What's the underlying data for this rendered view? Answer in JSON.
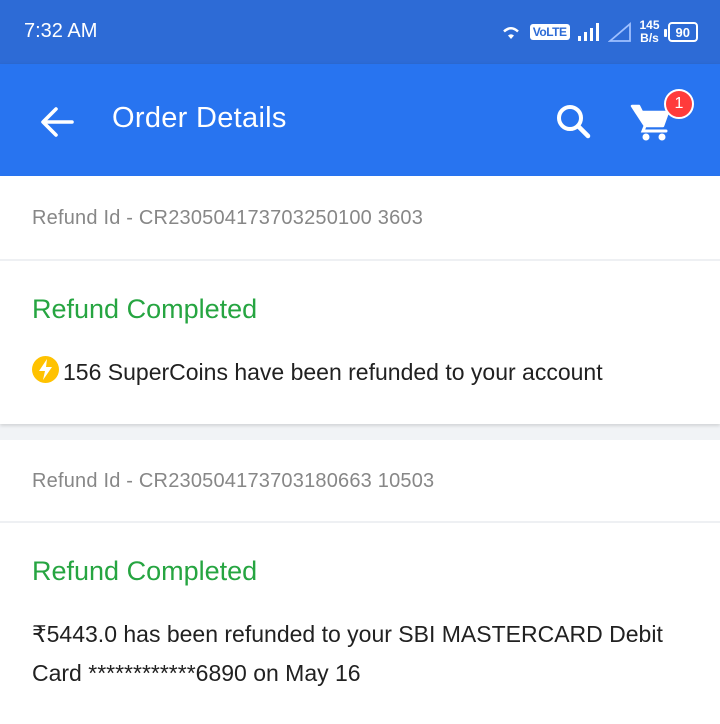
{
  "status_bar": {
    "time": "7:32 AM",
    "volte": "VoLTE",
    "speed_value": "145",
    "speed_unit": "B/s",
    "battery": "90"
  },
  "header": {
    "title": "Order Details",
    "cart_count": "1"
  },
  "refunds": [
    {
      "refund_id": "Refund Id - CR230504173703250100 3603",
      "status": "Refund Completed",
      "message": "156 SuperCoins have been refunded to your account",
      "icon": "supercoin-icon"
    },
    {
      "refund_id": "Refund Id - CR230504173703180663 10503",
      "status": "Refund Completed",
      "message": "₹5443.0 has been refunded to your SBI MASTERCARD Debit Card ************6890 on May 16"
    }
  ],
  "colors": {
    "app_bar": "#2874f0",
    "success": "#26a541",
    "badge": "#ff3b3b",
    "coin": "#ffc200"
  }
}
